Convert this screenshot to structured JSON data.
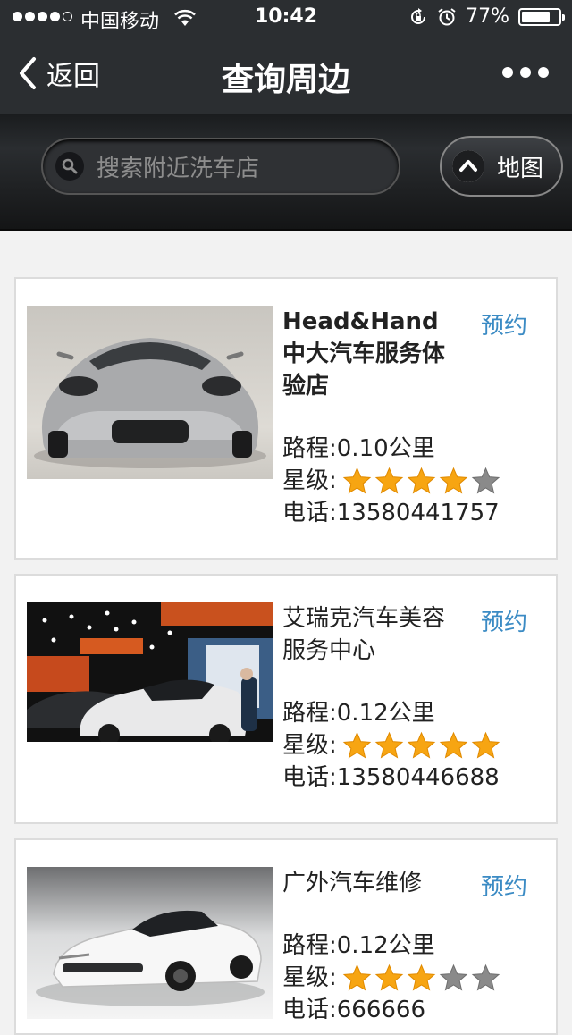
{
  "status_bar": {
    "carrier": "中国移动",
    "time": "10:42",
    "battery": "77%",
    "battery_level": 0.77
  },
  "nav": {
    "back_label": "返回",
    "title": "查询周边"
  },
  "search": {
    "placeholder": "搜索附近洗车店",
    "map_label": "地图"
  },
  "labels": {
    "distance": "路程: ",
    "rating": "星级:",
    "phone": "电话: ",
    "book": "预约"
  },
  "shops": [
    {
      "name": "Head&Hand中大汽车服务体验店",
      "distance": "0.10公里",
      "rating": 4,
      "phone": "13580441757"
    },
    {
      "name": "艾瑞克汽车美容服务中心",
      "distance": "0.12公里",
      "rating": 5,
      "phone": "13580446688"
    },
    {
      "name": "广外汽车维修",
      "distance": "0.12公里",
      "rating": 3,
      "phone": "666666"
    }
  ],
  "colors": {
    "header_bg": "#2b2e31",
    "book_link": "#3b8bc4",
    "star_on": "#f7a512",
    "star_off": "#8a8a8a"
  }
}
